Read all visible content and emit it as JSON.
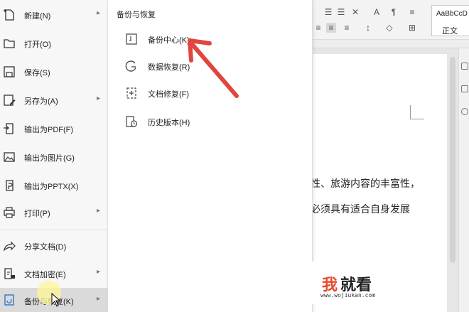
{
  "ribbon": {
    "style_preview": "AaBbCcD",
    "style_name": "正文"
  },
  "document": {
    "line1": "性、旅游内容的丰富性，",
    "line2": "必须具有适合自身发展"
  },
  "left_menu": {
    "items": [
      {
        "label": "新建(N)",
        "icon": "new-file-icon",
        "arrow": true
      },
      {
        "label": "打开(O)",
        "icon": "folder-open-icon",
        "arrow": false
      },
      {
        "label": "保存(S)",
        "icon": "save-icon",
        "arrow": false
      },
      {
        "label": "另存为(A)",
        "icon": "save-as-icon",
        "arrow": true
      },
      {
        "label": "输出为PDF(F)",
        "icon": "export-pdf-icon",
        "arrow": false
      },
      {
        "label": "输出为图片(G)",
        "icon": "export-image-icon",
        "arrow": false
      },
      {
        "label": "输出为PPTX(X)",
        "icon": "export-pptx-icon",
        "arrow": false
      },
      {
        "label": "打印(P)",
        "icon": "print-icon",
        "arrow": true
      },
      {
        "label": "分享文档(D)",
        "icon": "share-icon",
        "arrow": false
      },
      {
        "label": "文档加密(E)",
        "icon": "encrypt-icon",
        "arrow": true
      },
      {
        "label": "备份与恢复(K)",
        "icon": "backup-icon",
        "arrow": true
      }
    ]
  },
  "submenu": {
    "title": "备份与恢复",
    "items": [
      {
        "label": "备份中心(K)...",
        "icon": "backup-center-icon"
      },
      {
        "label": "数据恢复(R)",
        "icon": "data-recovery-icon"
      },
      {
        "label": "文档修复(F)",
        "icon": "doc-repair-icon"
      },
      {
        "label": "历史版本(H)",
        "icon": "history-version-icon"
      }
    ]
  },
  "watermark": {
    "logo_part1": "我",
    "logo_part2": "就看",
    "url": "www.wojiukan.com"
  },
  "colors": {
    "accent_red": "#e0463f",
    "watermark_red": "#e8492b"
  }
}
